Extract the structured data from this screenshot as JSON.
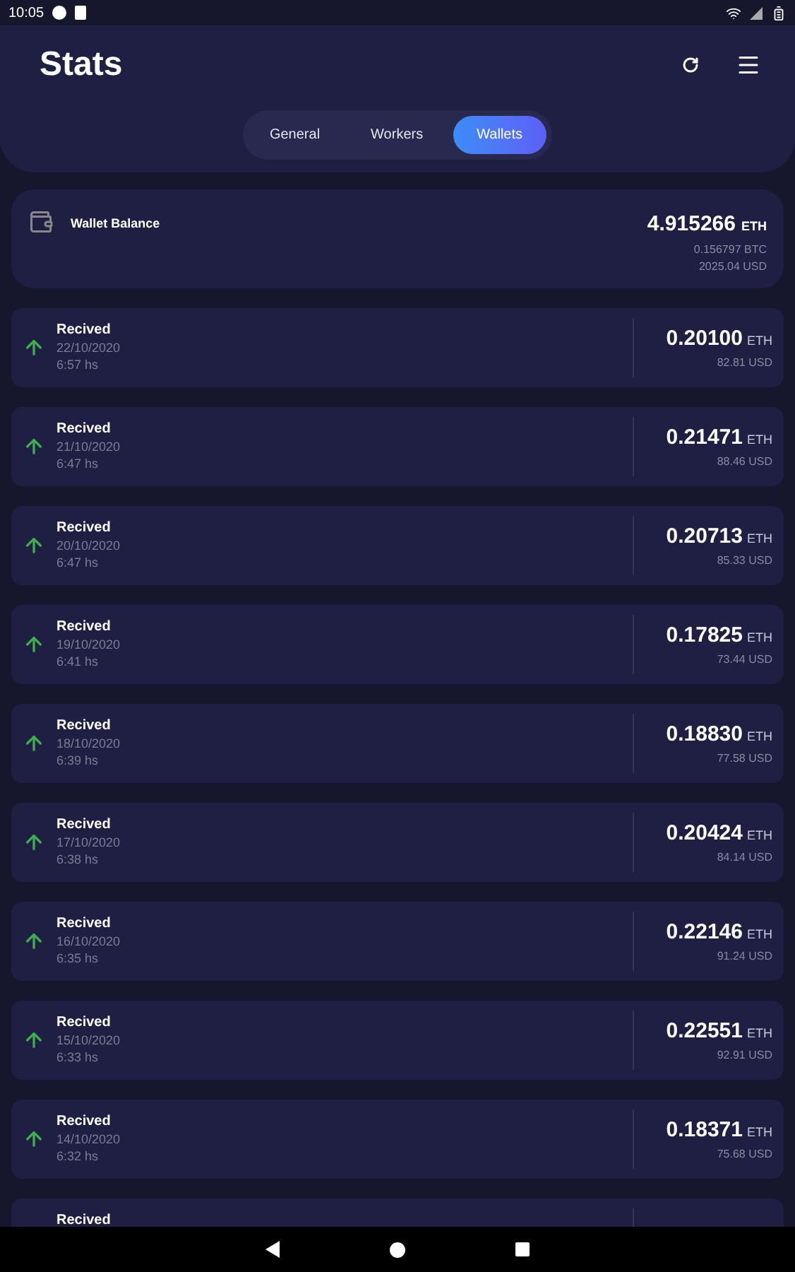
{
  "status_bar": {
    "time": "10:05"
  },
  "header": {
    "title": "Stats"
  },
  "tabs": [
    {
      "label": "General",
      "selected": false
    },
    {
      "label": "Workers",
      "selected": false
    },
    {
      "label": "Wallets",
      "selected": true
    }
  ],
  "balance": {
    "label": "Wallet Balance",
    "amount": "4.915266",
    "unit": "ETH",
    "btc": "0.156797 BTC",
    "usd": "2025.04 USD"
  },
  "transactions": [
    {
      "title": "Recived",
      "date": "22/10/2020",
      "time": "6:57 hs",
      "amount": "0.20100",
      "unit": "ETH",
      "usd": "82.81 USD"
    },
    {
      "title": "Recived",
      "date": "21/10/2020",
      "time": "6:47 hs",
      "amount": "0.21471",
      "unit": "ETH",
      "usd": "88.46 USD"
    },
    {
      "title": "Recived",
      "date": "20/10/2020",
      "time": "6:47 hs",
      "amount": "0.20713",
      "unit": "ETH",
      "usd": "85.33 USD"
    },
    {
      "title": "Recived",
      "date": "19/10/2020",
      "time": "6:41 hs",
      "amount": "0.17825",
      "unit": "ETH",
      "usd": "73.44 USD"
    },
    {
      "title": "Recived",
      "date": "18/10/2020",
      "time": "6:39 hs",
      "amount": "0.18830",
      "unit": "ETH",
      "usd": "77.58 USD"
    },
    {
      "title": "Recived",
      "date": "17/10/2020",
      "time": "6:38 hs",
      "amount": "0.20424",
      "unit": "ETH",
      "usd": "84.14 USD"
    },
    {
      "title": "Recived",
      "date": "16/10/2020",
      "time": "6:35 hs",
      "amount": "0.22146",
      "unit": "ETH",
      "usd": "91.24 USD"
    },
    {
      "title": "Recived",
      "date": "15/10/2020",
      "time": "6:33 hs",
      "amount": "0.22551",
      "unit": "ETH",
      "usd": "92.91 USD"
    },
    {
      "title": "Recived",
      "date": "14/10/2020",
      "time": "6:32 hs",
      "amount": "0.18371",
      "unit": "ETH",
      "usd": "75.68 USD"
    },
    {
      "title": "Recived"
    }
  ]
}
